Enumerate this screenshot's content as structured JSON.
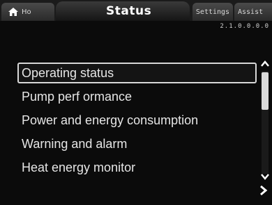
{
  "header": {
    "tabs": [
      {
        "label": "Ho",
        "icon": "home-icon"
      },
      {
        "label": "Status"
      },
      {
        "label": "Settings"
      },
      {
        "label": "Assist"
      }
    ],
    "active_tab": "Status",
    "version": "2.1.0.0.0.0"
  },
  "menu": {
    "items": [
      {
        "label": "Operating status"
      },
      {
        "label": "Pump perf ormance"
      },
      {
        "label": "Power and energy consumption"
      },
      {
        "label": "Warning and alarm"
      },
      {
        "label": "Heat energy monitor"
      }
    ],
    "selected_index": 0
  },
  "scrollbar": {
    "up_icon": "chevron-up-icon",
    "down_icon": "chevron-down-icon",
    "position_fraction": 0.0
  },
  "navigation": {
    "next_icon": "chevron-right-icon"
  },
  "colors": {
    "background": "#0b0b0b",
    "text": "#e6e6e6",
    "selection_border": "#d8d8d8",
    "tab_inactive": "#3a3a3a"
  }
}
